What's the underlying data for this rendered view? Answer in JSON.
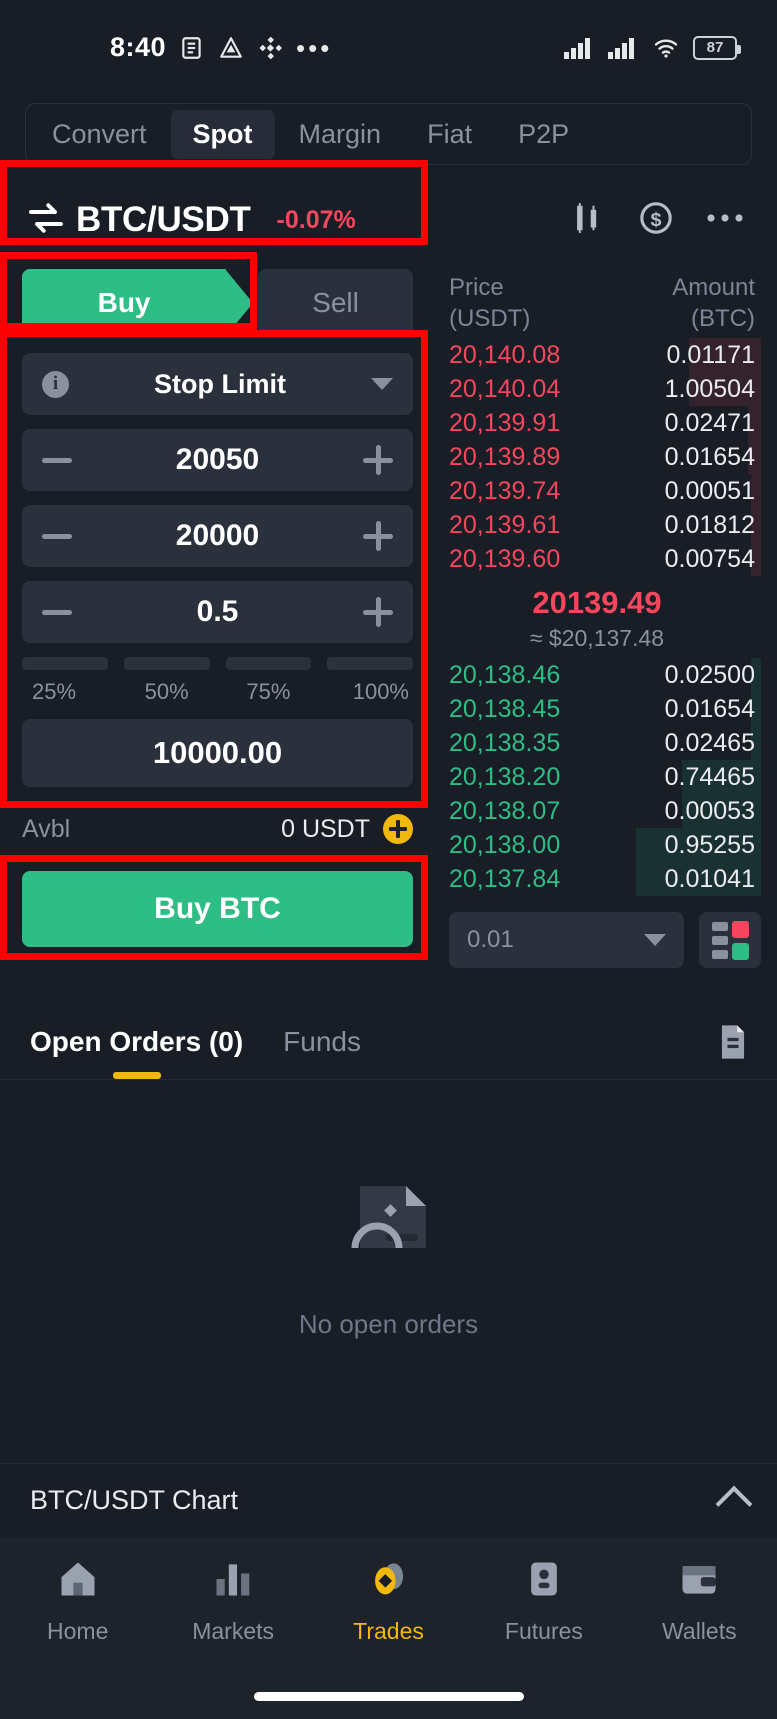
{
  "status_bar": {
    "time": "8:40",
    "battery": "87",
    "icons": [
      "notes-icon",
      "drive-icon",
      "binance-icon",
      "more-dots-icon",
      "signal-1-icon",
      "signal-2-icon",
      "wifi-icon",
      "battery-icon"
    ]
  },
  "top_tabs": [
    {
      "label": "Convert",
      "active": false
    },
    {
      "label": "Spot",
      "active": true
    },
    {
      "label": "Margin",
      "active": false
    },
    {
      "label": "Fiat",
      "active": false
    },
    {
      "label": "P2P",
      "active": false
    }
  ],
  "pair_header": {
    "pair": "BTC/USDT",
    "change": "-0.07%",
    "change_color": "#f6465d",
    "icons": [
      "swap-icon",
      "candlestick-chart-icon",
      "dollar-icon",
      "more-options-icon"
    ]
  },
  "side_tabs": {
    "buy_label": "Buy",
    "sell_label": "Sell",
    "active": "Buy",
    "buy_color": "#2ebd85"
  },
  "order_form": {
    "order_type": "Stop Limit",
    "stop_price": "20050",
    "limit_price": "20000",
    "amount": "0.5",
    "percents": [
      "25%",
      "50%",
      "75%",
      "100%"
    ],
    "total": "10000.00",
    "available_label": "Avbl",
    "available_value": "0 USDT",
    "submit_label": "Buy BTC"
  },
  "order_book": {
    "header": {
      "price": "Price",
      "price_unit": "(USDT)",
      "amount": "Amount",
      "amount_unit": "(BTC)"
    },
    "asks": [
      {
        "price": "20,140.08",
        "amount": "0.01171",
        "depth": 22
      },
      {
        "price": "20,140.04",
        "amount": "1.00504",
        "depth": 22
      },
      {
        "price": "20,139.91",
        "amount": "0.02471",
        "depth": 4
      },
      {
        "price": "20,139.89",
        "amount": "0.01654",
        "depth": 4
      },
      {
        "price": "20,139.74",
        "amount": "0.00051",
        "depth": 3
      },
      {
        "price": "20,139.61",
        "amount": "0.01812",
        "depth": 3
      },
      {
        "price": "20,139.60",
        "amount": "0.00754",
        "depth": 3
      }
    ],
    "mid_price": "20139.49",
    "mid_price_usd": "≈ $20,137.48",
    "bids": [
      {
        "price": "20,138.46",
        "amount": "0.02500",
        "depth": 3
      },
      {
        "price": "20,138.45",
        "amount": "0.01654",
        "depth": 3
      },
      {
        "price": "20,138.35",
        "amount": "0.02465",
        "depth": 3
      },
      {
        "price": "20,138.20",
        "amount": "0.74465",
        "depth": 24
      },
      {
        "price": "20,138.07",
        "amount": "0.00053",
        "depth": 24
      },
      {
        "price": "20,138.00",
        "amount": "0.95255",
        "depth": 38
      },
      {
        "price": "20,137.84",
        "amount": "0.01041",
        "depth": 38
      }
    ],
    "decimal_select": "0.01",
    "depth_toggle_icon": "order-book-view-icon"
  },
  "orders_section": {
    "tabs": [
      {
        "label": "Open Orders (0)",
        "active": true
      },
      {
        "label": "Funds",
        "active": false
      }
    ],
    "history_icon": "order-history-icon",
    "empty_text": "No open orders"
  },
  "chart_bar": {
    "label": "BTC/USDT Chart",
    "icon": "chevron-up-icon"
  },
  "bottom_nav": [
    {
      "label": "Home",
      "icon": "home-icon",
      "active": false
    },
    {
      "label": "Markets",
      "icon": "markets-bars-icon",
      "active": false
    },
    {
      "label": "Trades",
      "icon": "trades-coin-icon",
      "active": true
    },
    {
      "label": "Futures",
      "icon": "futures-icon",
      "active": false
    },
    {
      "label": "Wallets",
      "icon": "wallet-icon",
      "active": false
    }
  ]
}
